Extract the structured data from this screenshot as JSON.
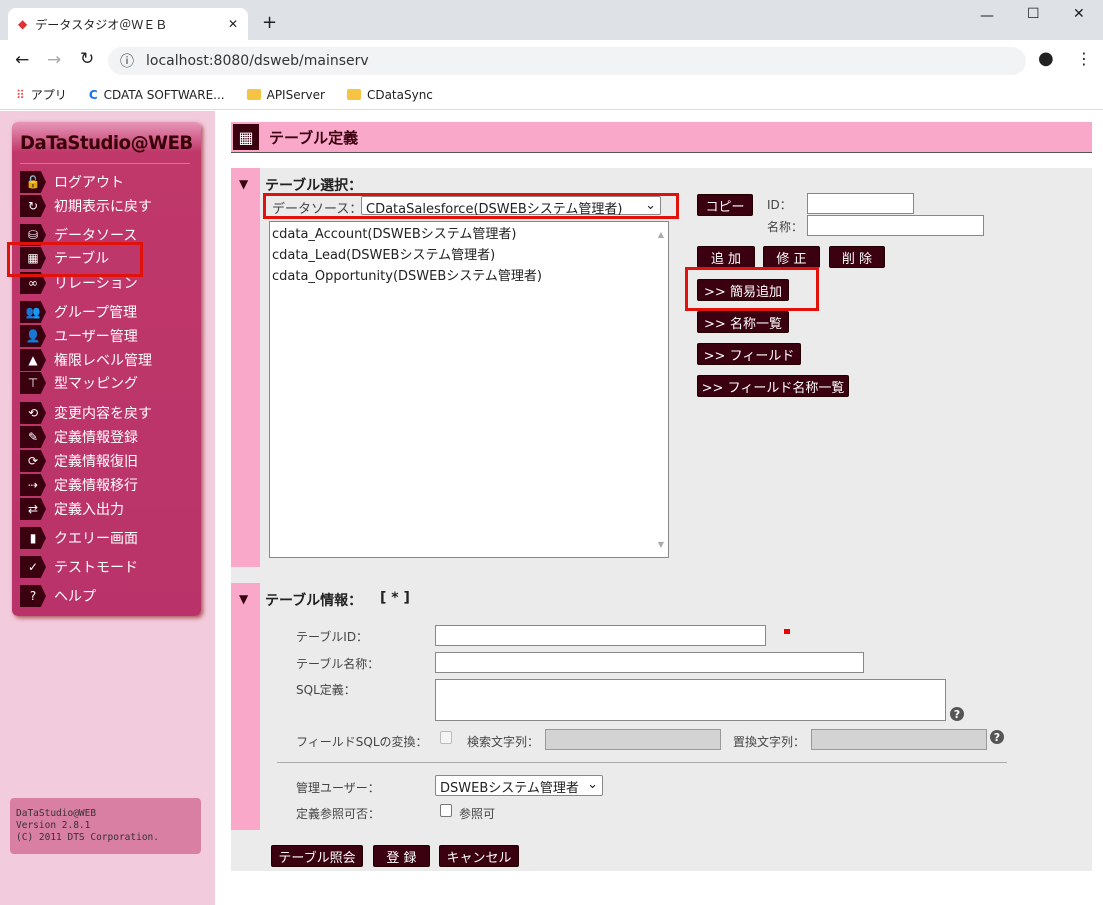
{
  "browser": {
    "tab_title": "データスタジオ＠ＷＥＢ",
    "url": "localhost:8080/dsweb/mainserv",
    "new_tab": "+",
    "bookmarks": [
      "アプリ",
      "CDATA SOFTWARE...",
      "APIServer",
      "CDataSync"
    ]
  },
  "sidebar": {
    "logo": "DaTaStudio@WEB",
    "items": [
      {
        "label": "ログアウト",
        "icon": "🔓"
      },
      {
        "label": "初期表示に戻す",
        "icon": "↻"
      },
      {
        "label": "データソース",
        "icon": "⛁"
      },
      {
        "label": "テーブル",
        "icon": "▦"
      },
      {
        "label": "リレーション",
        "icon": "∞"
      },
      {
        "label": "グループ管理",
        "icon": "👥"
      },
      {
        "label": "ユーザー管理",
        "icon": "👤"
      },
      {
        "label": "権限レベル管理",
        "icon": "▲"
      },
      {
        "label": "型マッピング",
        "icon": "⊤"
      },
      {
        "label": "変更内容を戻す",
        "icon": "⟲"
      },
      {
        "label": "定義情報登録",
        "icon": "✎"
      },
      {
        "label": "定義情報復旧",
        "icon": "⟳"
      },
      {
        "label": "定義情報移行",
        "icon": "⇢"
      },
      {
        "label": "定義入出力",
        "icon": "⇄"
      },
      {
        "label": "クエリー画面",
        "icon": "▮"
      },
      {
        "label": "テストモード",
        "icon": "✓"
      },
      {
        "label": "ヘルプ",
        "icon": "?"
      }
    ],
    "footer": [
      "DaTaStudio@WEB",
      "Version 2.8.1",
      "(C) 2011 DTS Corporation."
    ]
  },
  "header": {
    "title": "テーブル定義"
  },
  "select_section": {
    "title": "テーブル選択：",
    "datasource_label": "データソース：",
    "datasource_value": "CDataSalesforce(DSWEBシステム管理者)",
    "tables": [
      "cdata_Account(DSWEBシステム管理者)",
      "cdata_Lead(DSWEBシステム管理者)",
      "cdata_Opportunity(DSWEBシステム管理者)"
    ],
    "copy": "コピー",
    "id_label": "ID：",
    "name_label": "名称：",
    "add": "追 加",
    "edit": "修 正",
    "delete": "削 除",
    "quick_add": ">> 簡易追加",
    "name_list": ">> 名称一覧",
    "field": ">> フィールド",
    "field_name_list": ">> フィールド名称一覧"
  },
  "info_section": {
    "title": "テーブル情報：",
    "mode": "[ * ]",
    "table_id": "テーブルID：",
    "table_name": "テーブル名称：",
    "sql": "SQL定義：",
    "field_sql": "フィールドSQLの変換：",
    "search": "検索文字列：",
    "replace": "置換文字列：",
    "admin_user": "管理ユーザー：",
    "admin_value": "DSWEBシステム管理者",
    "ref": "定義参照可否：",
    "ref_check": "参照可",
    "help": "?"
  },
  "buttons": {
    "lookup": "テーブル照会",
    "register": "登 録",
    "cancel": "キャンセル"
  }
}
